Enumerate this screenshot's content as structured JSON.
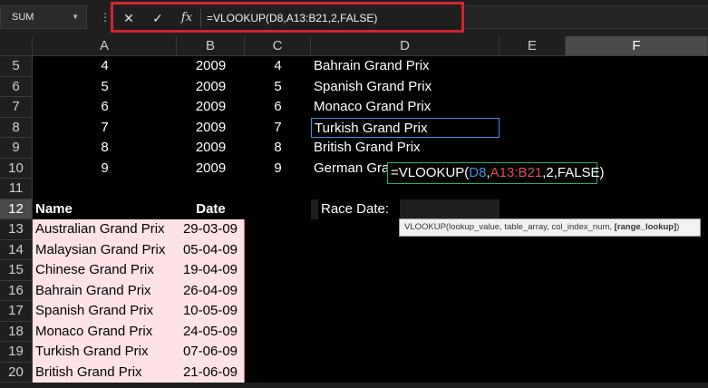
{
  "formula_bar": {
    "name_box": "SUM",
    "dots": "⋮",
    "cancel_icon": "✕",
    "enter_icon": "✓",
    "function_icon": "fx",
    "formula": "=VLOOKUP(D8,A13:B21,2,FALSE)"
  },
  "columns": [
    "A",
    "B",
    "C",
    "D",
    "E",
    "F"
  ],
  "selected_column": "F",
  "rows": [
    {
      "num": "5",
      "a": "4",
      "b": "2009",
      "c": "4",
      "d": "Bahrain Grand Prix"
    },
    {
      "num": "6",
      "a": "5",
      "b": "2009",
      "c": "5",
      "d": "Spanish Grand Prix"
    },
    {
      "num": "7",
      "a": "6",
      "b": "2009",
      "c": "6",
      "d": "Monaco Grand Prix"
    },
    {
      "num": "8",
      "a": "7",
      "b": "2009",
      "c": "7",
      "d": "Turkish Grand Prix"
    },
    {
      "num": "9",
      "a": "8",
      "b": "2009",
      "c": "8",
      "d": "British Grand Prix"
    },
    {
      "num": "10",
      "a": "9",
      "b": "2009",
      "c": "9",
      "d": "German Grand Prix"
    },
    {
      "num": "11",
      "a": "",
      "b": "",
      "c": "",
      "d": ""
    },
    {
      "num": "12",
      "a": "Name",
      "b": "Date",
      "c": "",
      "d": "Race Date:"
    },
    {
      "num": "13",
      "a": "Australian Grand Prix",
      "b": "29-03-09",
      "c": "",
      "d": ""
    },
    {
      "num": "14",
      "a": "Malaysian Grand Prix",
      "b": "05-04-09",
      "c": "",
      "d": ""
    },
    {
      "num": "15",
      "a": "Chinese Grand Prix",
      "b": "19-04-09",
      "c": "",
      "d": ""
    },
    {
      "num": "16",
      "a": "Bahrain Grand Prix",
      "b": "26-04-09",
      "c": "",
      "d": ""
    },
    {
      "num": "17",
      "a": "Spanish Grand Prix",
      "b": "10-05-09",
      "c": "",
      "d": ""
    },
    {
      "num": "18",
      "a": "Monaco Grand Prix",
      "b": "24-05-09",
      "c": "",
      "d": ""
    },
    {
      "num": "19",
      "a": "Turkish Grand Prix",
      "b": "07-06-09",
      "c": "",
      "d": ""
    },
    {
      "num": "20",
      "a": "British Grand Prix",
      "b": "21-06-09",
      "c": "",
      "d": ""
    }
  ],
  "selected_row": "12",
  "edit_cell": {
    "prefix": "=VLOOKUP(",
    "ref1": "D8",
    "comma1": ",",
    "ref2": "A13:B21",
    "rest": ",2,FALSE)"
  },
  "tooltip": {
    "main": "VLOOKUP(lookup_value, table_array, col_index_num, ",
    "bold": "[range_lookup]",
    "end": ")"
  },
  "colors": {
    "highlight_border": "#d0262f",
    "table_fill": "#fde3e6",
    "ref_blue": "#4a8fe0",
    "ref_red": "#e04d58",
    "edit_border": "#35a86a"
  }
}
